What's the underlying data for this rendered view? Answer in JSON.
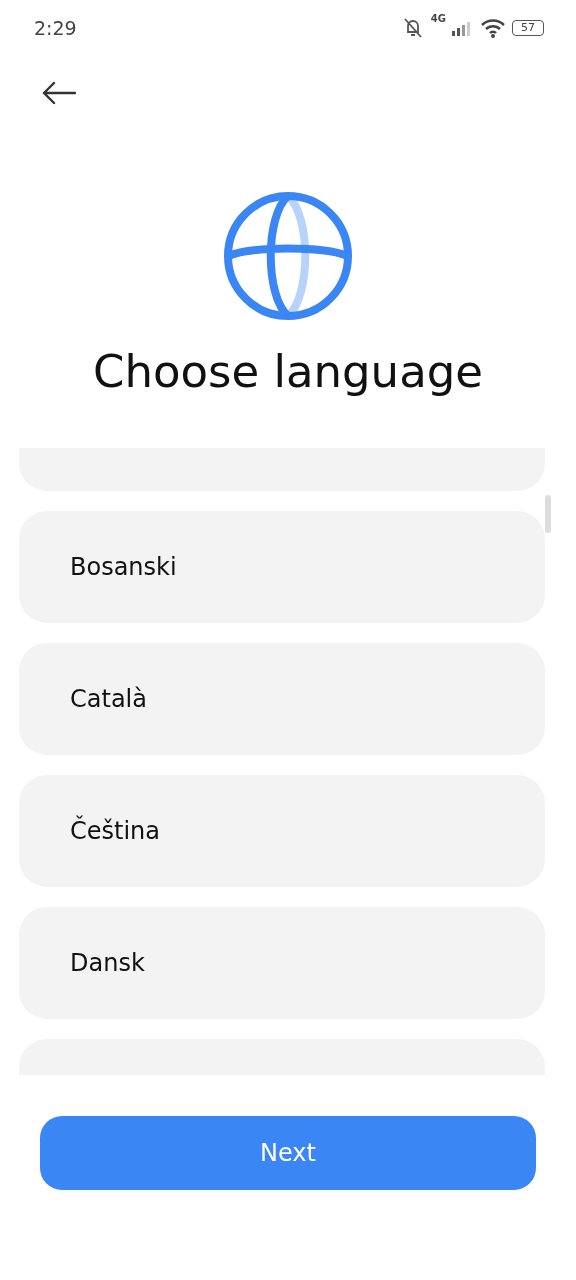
{
  "status_bar": {
    "time": "2:29",
    "network": "4G",
    "battery": "57"
  },
  "title": "Choose language",
  "languages": [
    {
      "label": "Bosanski"
    },
    {
      "label": "Català"
    },
    {
      "label": "Čeština"
    },
    {
      "label": "Dansk"
    }
  ],
  "next_button": "Next"
}
